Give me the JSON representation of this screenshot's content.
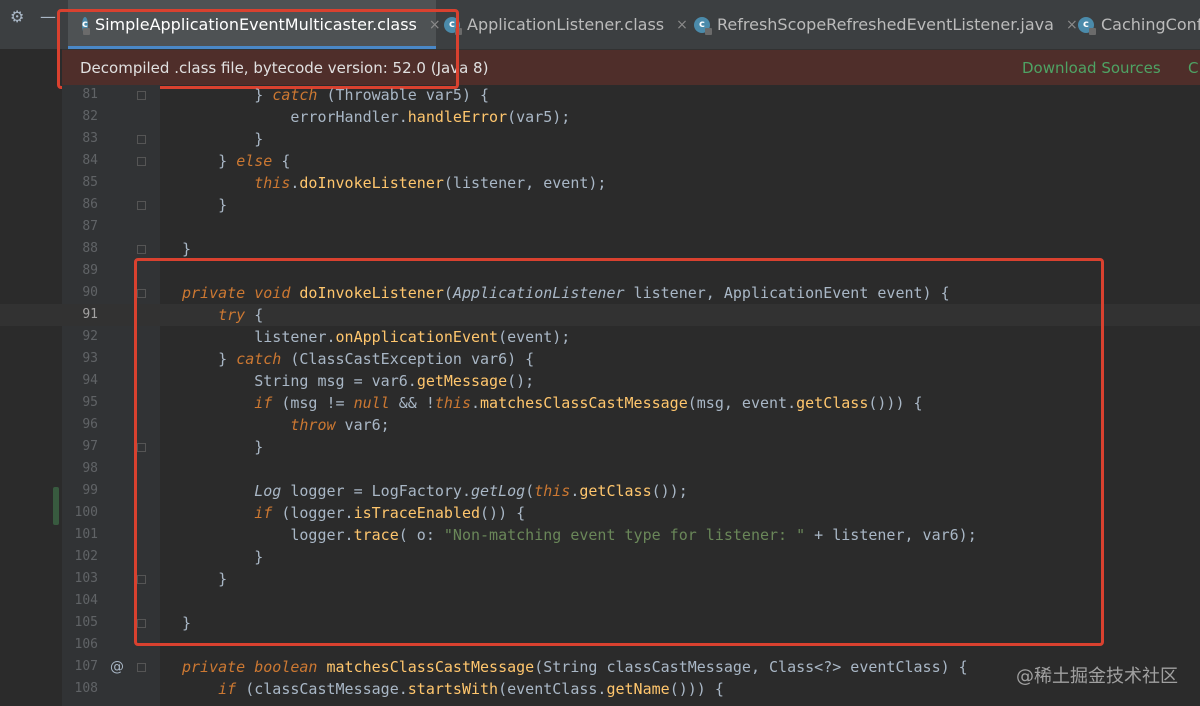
{
  "toolbar": {
    "settings_icon": "gear-icon",
    "minimize_icon": "minus-icon"
  },
  "tabs": [
    {
      "label": "SimpleApplicationEventMulticaster.class",
      "active": true,
      "close": "×"
    },
    {
      "label": "ApplicationListener.class",
      "active": false,
      "close": "×"
    },
    {
      "label": "RefreshScopeRefreshedEventListener.java",
      "active": false,
      "close": "×"
    },
    {
      "label": "CachingConf",
      "active": false,
      "close": ""
    }
  ],
  "banner": {
    "message": "Decompiled .class file, bytecode version: 52.0 (Java 8)",
    "download_sources": "Download Sources",
    "choose_sources": "C"
  },
  "code": {
    "lines": [
      {
        "n": "81",
        "html": "        } <span class=\"kwi\">catch</span> (<span class=\"ty\">Throwable</span> var5) {"
      },
      {
        "n": "82",
        "html": "            errorHandler.<span class=\"fo\">handleError</span>(var5);"
      },
      {
        "n": "83",
        "html": "        }"
      },
      {
        "n": "84",
        "html": "    } <span class=\"kwi\">else</span> {"
      },
      {
        "n": "85",
        "html": "        <span class=\"kwi\">this</span>.<span class=\"fo\">doInvokeListener</span>(listener, event);"
      },
      {
        "n": "86",
        "html": "    }"
      },
      {
        "n": "87",
        "html": ""
      },
      {
        "n": "88",
        "html": "}"
      },
      {
        "n": "89",
        "html": ""
      },
      {
        "n": "90",
        "html": "<span class=\"kwi\">private void</span> <span class=\"fo\">doInvokeListener</span>(<span class=\"it\">ApplicationListener</span> listener, ApplicationEvent event) {"
      },
      {
        "n": "91",
        "html": "    <span class=\"kwi\">try</span> {"
      },
      {
        "n": "92",
        "html": "        listener.<span class=\"fo\">onApplicationEvent</span>(event);"
      },
      {
        "n": "93",
        "html": "    } <span class=\"kwi\">catch</span> (ClassCastException var6) {"
      },
      {
        "n": "94",
        "html": "        String msg = var6.<span class=\"fo\">getMessage</span>();"
      },
      {
        "n": "95",
        "html": "        <span class=\"kwi\">if</span> (msg != <span class=\"kwi\">null</span> &amp;&amp; !<span class=\"kwi\">this</span>.<span class=\"fo\">matchesClassCastMessage</span>(msg, event.<span class=\"fo\">getClass</span>())) {"
      },
      {
        "n": "96",
        "html": "            <span class=\"kwi\">throw</span> var6;"
      },
      {
        "n": "97",
        "html": "        }"
      },
      {
        "n": "98",
        "html": ""
      },
      {
        "n": "99",
        "html": "        <span class=\"it\">Log</span> logger = LogFactory.<span class=\"it\">getLog</span>(<span class=\"kwi\">this</span>.<span class=\"fo\">getClass</span>());"
      },
      {
        "n": "100",
        "html": "        <span class=\"kwi\">if</span> (logger.<span class=\"fo\">isTraceEnabled</span>()) {"
      },
      {
        "n": "101",
        "html": "            logger.<span class=\"fo\">trace</span>( o: <span class=\"st\">\"Non-matching event type for listener: \"</span> + listener, var6);"
      },
      {
        "n": "102",
        "html": "        }"
      },
      {
        "n": "103",
        "html": "    }"
      },
      {
        "n": "104",
        "html": ""
      },
      {
        "n": "105",
        "html": "}"
      },
      {
        "n": "106",
        "html": ""
      },
      {
        "n": "107",
        "html": "<span class=\"kwi\">private boolean</span> <span class=\"fo\">matchesClassCastMessage</span>(String classCastMessage, Class&lt;?&gt; eventClass) {"
      },
      {
        "n": "108",
        "html": "    <span class=\"kwi\">if</span> (classCastMessage.<span class=\"fo\">startsWith</span>(eventClass.<span class=\"fo\">getName</span>())) {"
      }
    ],
    "current_line": "91",
    "annotation_marker": "@"
  },
  "watermark": "@稀土掘金技术社区"
}
